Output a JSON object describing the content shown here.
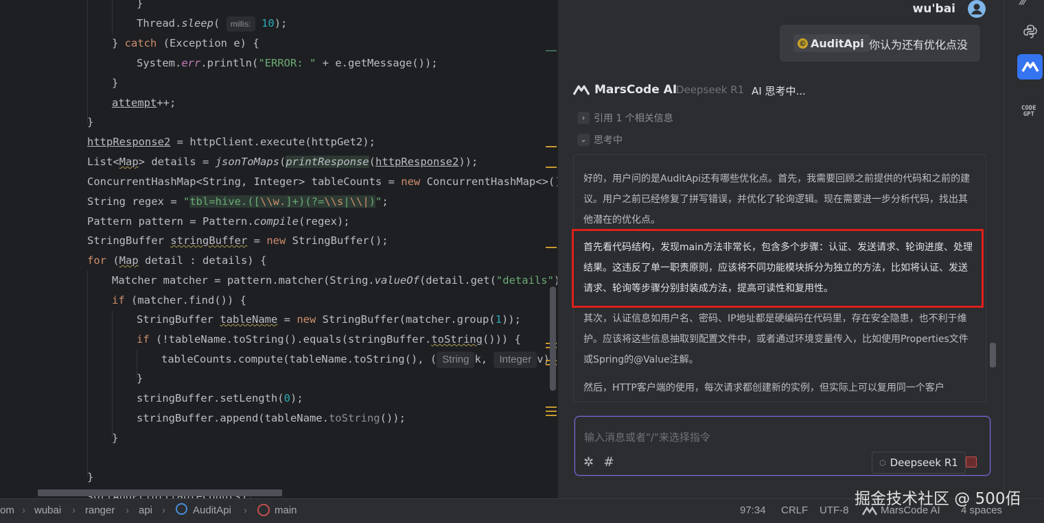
{
  "editor": {
    "param_hint_millis": "millis:",
    "type_hint_string": "String",
    "type_hint_integer": "Integer",
    "tokens": {
      "brace": "}",
      "thread": "Thread.",
      "sleep": "sleep",
      "paren_open": "(",
      "ten": "10",
      "close_semi": ");",
      "brace_catch": "} ",
      "catch": "catch",
      "catch_rest": " (Exception e) {",
      "system": "System.",
      "err": "err",
      "println": ".println(",
      "error_str": "\"ERROR: \"",
      "println_rest": " + e.getMessage());",
      "attempt": "attempt",
      "plusplus": "++;",
      "httpresp2": "httpResponse2",
      "exec_rest": " = httpClient.execute(httpGet2);",
      "list_open": "List<",
      "map": "Map",
      "details_eq": "> details = ",
      "jsonToMaps": "jsonToMaps",
      "printResponse": "printResponse",
      "httpResponse2_arg": "httpResponse2",
      "closes2": "));",
      "chm_decl": "ConcurrentHashMap<String, Integer> tableCounts = ",
      "new": "new",
      "chm_new": " ConcurrentHashMap<>();",
      "string_regex": "String regex = ",
      "regex_q1": "\"",
      "regex_a": "tbl=hive.([",
      "regex_b": "\\\\w.",
      "regex_c": "]+)(?=",
      "regex_d": "\\\\s",
      "regex_e": "|",
      "regex_f": "\\\\|",
      "regex_g": ")",
      "regex_q2": "\"",
      "semi": ";",
      "pattern_decl": "Pattern pattern = Pattern.",
      "compile": "compile",
      "compile_rest": "(regex);",
      "sb_decl": "StringBuffer ",
      "stringBuffer": "stringBuffer",
      "sb_eq": " = ",
      "sb_new": " StringBuffer();",
      "for": "for",
      "for_rest_open": " (",
      "for_map": "Map",
      "for_rest": " detail : details) {",
      "matcher_a": "Matcher matcher = pattern.matcher(String.",
      "valueOf": "valueOf",
      "matcher_b": "(detail.get(",
      "details_str": "\"details\"",
      "matcher_c": ")));",
      "if": "if",
      "if_find": " (matcher.find()) {",
      "tn_decl": "StringBuffer ",
      "tableName": "tableName",
      "tn_eq": " = ",
      "tn_new": " StringBuffer(matcher.group(",
      "one": "1",
      "tn_close": "));",
      "if2_a": " (!tableName.toString().equals(stringBuffer.",
      "toString": "toString",
      "if2_b": "())) {",
      "compute_a": "tableCounts.compute(tableName.toString(), (",
      "k": "k,",
      "v": "v)",
      "setlen_a": "stringBuffer.setLength(",
      "zero": "0",
      "append_a": "stringBuffer.append(tableName.",
      "append_b": "());",
      "last_line": "sortAndPrint(tableCounts);"
    }
  },
  "chat": {
    "user_name": "wu'bai",
    "user_chip": "AuditApi",
    "user_message": "你认为还有优化点没",
    "ai_name": "MarsCode AI",
    "ai_model": "Deepseek R1",
    "ai_status": "AI 思考中...",
    "ref_label": "引用 1 个相关信息",
    "thinking_label": "思考中",
    "thinking_paragraphs": [
      "好的，用户问的是AuditApi还有哪些优化点。首先，我需要回顾之前提供的代码和之前的建议。用户之前已经修复了拼写错误，并优化了轮询逻辑。现在需要进一步分析代码，找出其他潜在的优化点。",
      "首先看代码结构，发现main方法非常长，包含多个步骤：认证、发送请求、轮询进度、处理结果。这违反了单一职责原则，应该将不同功能模块拆分为独立的方法，比如将认证、发送请求、轮询等步骤分别封装成方法，提高可读性和复用性。",
      "其次，认证信息如用户名、密码、IP地址都是硬编码在代码里，存在安全隐患，也不利于维护。应该将这些信息抽取到配置文件中，或者通过环境变量传入，比如使用Properties文件或Spring的@Value注解。",
      "然后，HTTP客户端的使用，每次请求都创建新的实例，但实际上可以复用同一个客户"
    ],
    "input_placeholder": "输入消息或者\"/\"来选择指令",
    "model_select": "Deepseek R1",
    "highlight_color": "#e0201a"
  },
  "right_strip": {
    "code_gpt_line1": "CODE",
    "code_gpt_line2": "GPT"
  },
  "status": {
    "crumbs": [
      "om",
      "wubai",
      "ranger",
      "api",
      "AuditApi",
      "main"
    ],
    "cursor": "97:34",
    "line_sep": "CRLF",
    "encoding": "UTF-8",
    "plugin": "MarsCode AI",
    "indent": "4 spaces"
  },
  "watermark": "掘金技术社区 @ 500佰"
}
